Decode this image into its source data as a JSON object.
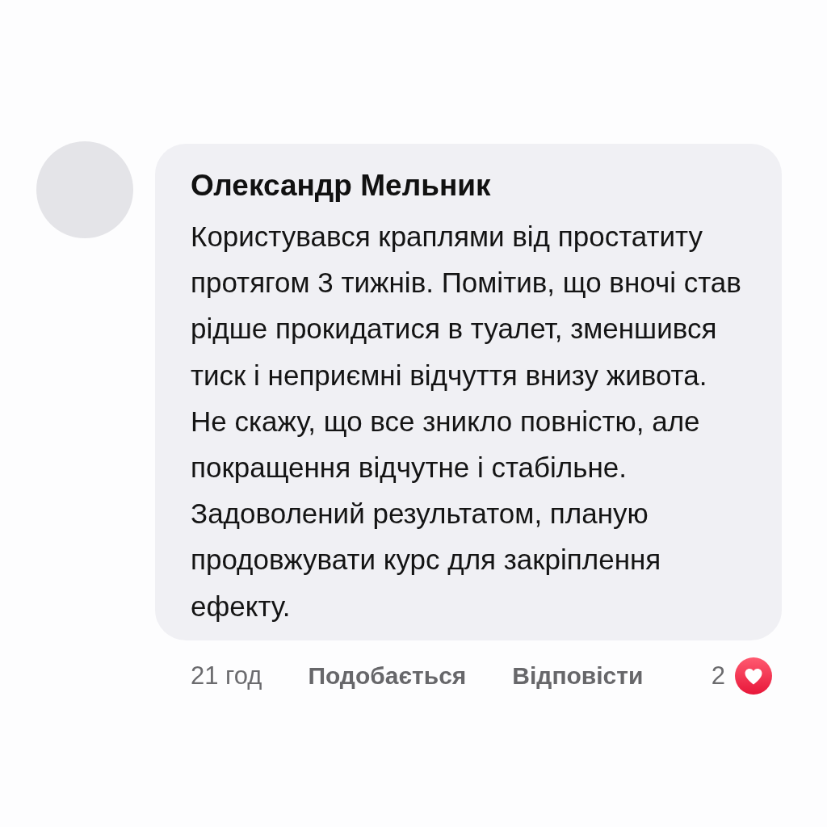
{
  "comment": {
    "author": "Олександр Мельник",
    "text": "Користувався краплями від простатиту протягом 3 тижнів. Помітив, що вночі став рідше прокидатися в туалет, зменшився тиск і неприємні відчуття внизу живота. Не скажу, що все зникло повністю, але покращення відчутне і стабільне. Задоволений результатом, планую продовжувати курс для закріплення ефекту.",
    "time": "21 год",
    "actions": [
      {
        "label": "Подобається"
      },
      {
        "label": "Відповісти"
      }
    ],
    "reactions": {
      "count": "2"
    }
  }
}
